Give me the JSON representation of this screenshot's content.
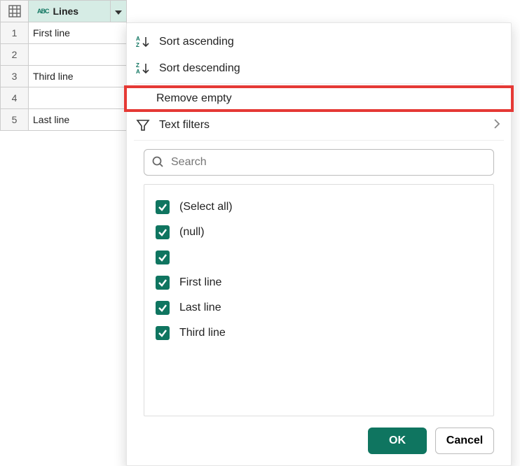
{
  "column": {
    "name": "Lines",
    "type_icon": "ABC"
  },
  "rows": [
    {
      "n": "1",
      "value": "First line"
    },
    {
      "n": "2",
      "value": ""
    },
    {
      "n": "3",
      "value": "Third line"
    },
    {
      "n": "4",
      "value": ""
    },
    {
      "n": "5",
      "value": "Last line"
    }
  ],
  "menu": {
    "sort_asc": "Sort ascending",
    "sort_desc": "Sort descending",
    "remove_empty": "Remove empty",
    "text_filters": "Text filters"
  },
  "search": {
    "placeholder": "Search"
  },
  "filter_values": [
    {
      "label": "(Select all)",
      "checked": true
    },
    {
      "label": "(null)",
      "checked": true
    },
    {
      "label": "",
      "checked": true
    },
    {
      "label": "First line",
      "checked": true
    },
    {
      "label": "Last line",
      "checked": true
    },
    {
      "label": "Third line",
      "checked": true
    }
  ],
  "buttons": {
    "ok": "OK",
    "cancel": "Cancel"
  }
}
